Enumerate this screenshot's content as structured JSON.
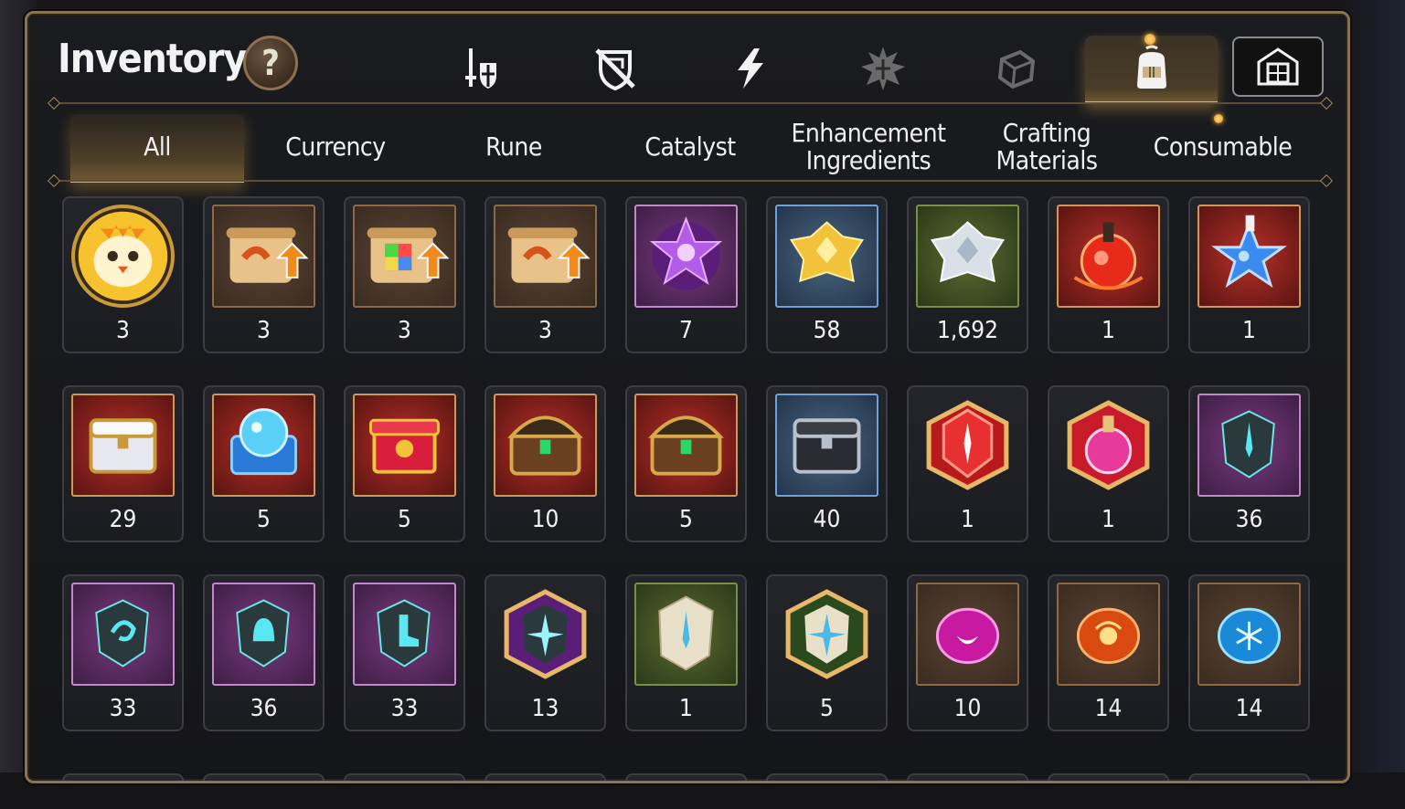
{
  "inventory": {
    "title": "Inventory",
    "help_label": "?",
    "category_tabs": [
      {
        "name": "gear-tab",
        "icon": "sword-shield-icon",
        "active": false
      },
      {
        "name": "artifact-tab",
        "icon": "crossed-shield-icon",
        "active": false
      },
      {
        "name": "skill-tab",
        "icon": "lightning-icon",
        "active": false
      },
      {
        "name": "spirit-tab",
        "icon": "spiked-emblem-icon",
        "active": false
      },
      {
        "name": "chest-tab",
        "icon": "dice-box-icon",
        "active": false
      },
      {
        "name": "items-tab",
        "icon": "backpack-icon",
        "active": true
      }
    ],
    "special_button_icon": "storage-house-icon",
    "sub_tabs": [
      {
        "label": "All",
        "active": true
      },
      {
        "label": "Currency",
        "active": false
      },
      {
        "label": "Rune",
        "active": false
      },
      {
        "label": "Catalyst",
        "active": false
      },
      {
        "label": "Enhancement\nIngredients",
        "active": false
      },
      {
        "label": "Crafting\nMaterials",
        "active": false
      },
      {
        "label": "Consumable",
        "active": false
      }
    ],
    "accent_color": "#e8b24d",
    "items": [
      {
        "icon": "chick-mascot-icon",
        "qty": "3",
        "frame": "round-gold"
      },
      {
        "icon": "upgrade-scroll-icon",
        "qty": "3",
        "frame": "brown"
      },
      {
        "icon": "rainbow-cube-scroll-icon",
        "qty": "3",
        "frame": "brown"
      },
      {
        "icon": "upgrade-scroll-icon",
        "qty": "3",
        "frame": "brown"
      },
      {
        "icon": "purple-crystal-icon",
        "qty": "7",
        "frame": "purple"
      },
      {
        "icon": "gold-crystal-icon",
        "qty": "58",
        "frame": "blue"
      },
      {
        "icon": "silver-crystal-icon",
        "qty": "1,692",
        "frame": "green"
      },
      {
        "icon": "red-potion-icon",
        "qty": "1",
        "frame": "red"
      },
      {
        "icon": "star-potion-icon",
        "qty": "1",
        "frame": "red"
      },
      {
        "icon": "white-gold-chest-icon",
        "qty": "29",
        "frame": "red"
      },
      {
        "icon": "blue-orb-chest-icon",
        "qty": "5",
        "frame": "red"
      },
      {
        "icon": "red-gift-box-icon",
        "qty": "5",
        "frame": "red"
      },
      {
        "icon": "treasure-chest-icon",
        "qty": "10",
        "frame": "red"
      },
      {
        "icon": "treasure-chest-icon",
        "qty": "5",
        "frame": "red"
      },
      {
        "icon": "dark-steel-chest-icon",
        "qty": "40",
        "frame": "blue"
      },
      {
        "icon": "red-sword-gem-icon",
        "qty": "1",
        "frame": "hex-red"
      },
      {
        "icon": "pink-flask-icon",
        "qty": "1",
        "frame": "hex-red"
      },
      {
        "icon": "sword-rune-stone-icon",
        "qty": "36",
        "frame": "purple"
      },
      {
        "icon": "spiral-rune-stone-icon",
        "qty": "33",
        "frame": "purple"
      },
      {
        "icon": "bell-rune-stone-icon",
        "qty": "36",
        "frame": "purple"
      },
      {
        "icon": "boot-rune-stone-icon",
        "qty": "33",
        "frame": "purple"
      },
      {
        "icon": "star-rune-stone-icon",
        "qty": "13",
        "frame": "hex-purple"
      },
      {
        "icon": "sword-tablet-icon",
        "qty": "1",
        "frame": "green"
      },
      {
        "icon": "star-tablet-icon",
        "qty": "5",
        "frame": "hex-green"
      },
      {
        "icon": "moon-orb-icon",
        "qty": "10",
        "frame": "brown"
      },
      {
        "icon": "fire-orb-icon",
        "qty": "14",
        "frame": "brown"
      },
      {
        "icon": "frost-orb-icon",
        "qty": "14",
        "frame": "brown"
      }
    ]
  }
}
